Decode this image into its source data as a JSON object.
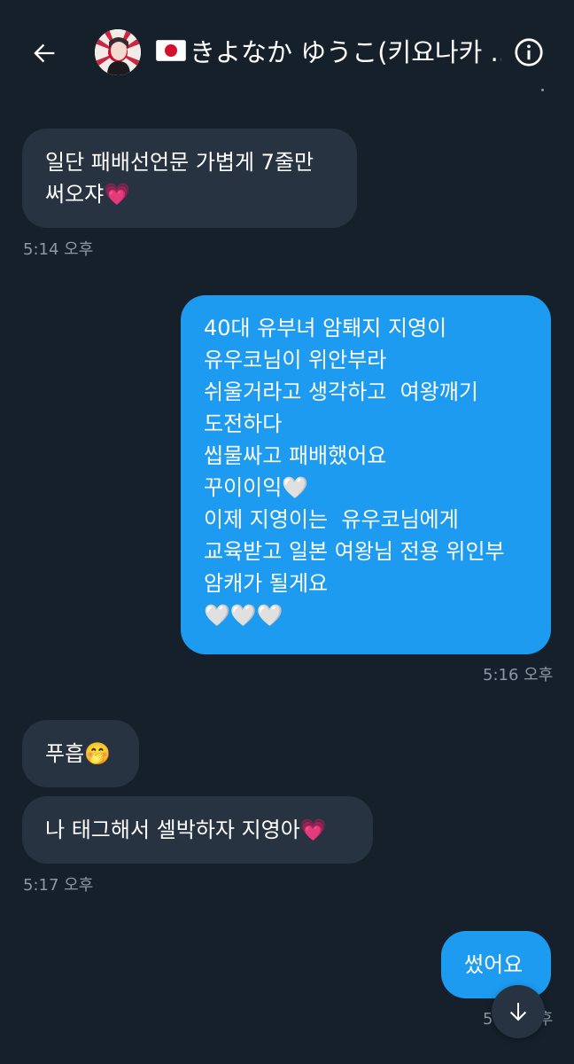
{
  "header": {
    "back_icon": "arrow-left-icon",
    "title": "きよなか ゆうこ(키요나카 ...",
    "flag": "japan-flag-icon",
    "info_icon": "info-icon"
  },
  "messages": [
    {
      "direction": "in",
      "text": "일단 패배선언문 가볍게 7줄만\n써오쟈💗"
    },
    {
      "direction": "out",
      "text": "40대 유부녀 암퇘지 지영이\n유우코님이 위안부라\n쉬울거라고 생각하고  여왕깨기\n도전하다\n씹물싸고 패배했어요\n꾸이이익🤍\n이제 지영이는  유우코님에게\n교육받고 일본 여왕님 전용 위인부\n암캐가 될게요\n🤍🤍🤍"
    },
    {
      "direction": "in",
      "text": "푸흡🤭"
    },
    {
      "direction": "in",
      "text": "나 태그해서 셀박하자 지영아💗"
    },
    {
      "direction": "out",
      "text": "썼어요"
    }
  ],
  "timestamps": [
    "5:14 오후",
    "5:16 오후",
    "5:17 오후",
    "5:17 오후"
  ],
  "scroll_button_icon": "arrow-down-icon",
  "colors": {
    "background": "#15202b",
    "incoming_bubble": "#273340",
    "outgoing_bubble": "#1d9bf0",
    "timestamp": "#8b98a5"
  }
}
